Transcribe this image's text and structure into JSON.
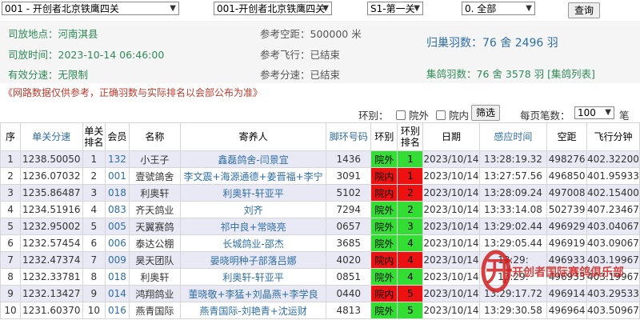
{
  "toolbar": {
    "select1": "001 - 开创者北京铁鹰四关",
    "select2": "001-开创者北京铁鹰四关",
    "select3": "S1-第一关",
    "select4": "0. 全部",
    "query_button": "查询"
  },
  "info": {
    "release_place_label": "司放地点：",
    "release_place": "河南淇县",
    "release_time_label": "司放时间：",
    "release_time": "2023-10-14 06:46:00",
    "valid_speed_label": "有效分速：",
    "valid_speed": "无限制",
    "ref_distance_label": "参考空距：",
    "ref_distance": "500000 米",
    "ref_flight_label": "参考飞行：",
    "ref_flight": "已结束",
    "ref_speed_label": "参考分速：",
    "ref_speed": "已结束",
    "homing_label": "归巢羽数：",
    "homing": "76 舍 2496 羽",
    "collect_label": "集鸽羽数：",
    "collect": "76 舍 3578 羽",
    "collect_list_link": "[集鸽列表]"
  },
  "notice": "《网路数据仅供参考，正确羽数与实际排名以会部公布为准》",
  "filter": {
    "ring_label": "环别：",
    "outer_label": "院外",
    "inner_label": "院内",
    "filter_button": "筛选",
    "page_size_label": "每页笔数：",
    "page_size": "100",
    "unit": "笔"
  },
  "table": {
    "headers": [
      "序",
      "单关分速",
      "单关排名",
      "会员",
      "名称",
      "寄养人",
      "脚环号码",
      "环别",
      "环别排名",
      "日期",
      "感应时间",
      "空距",
      "飞行分钟"
    ],
    "rows": [
      {
        "no": "1",
        "speed": "1238.50050",
        "rank": "1",
        "member": "132",
        "name": "小王子",
        "fosterer": "鑫磊鸽舍-闫景宜",
        "ring": "1436",
        "type": "院外",
        "type_rank": "1",
        "date": "2023/10/14",
        "time": "13:28:19.32",
        "distance": "498276",
        "minutes": "402.32200"
      },
      {
        "no": "2",
        "speed": "1236.07032",
        "rank": "2",
        "member": "001",
        "name": "壹號鴿舍",
        "fosterer": "李文震+海源通德+姜晋福+李宁",
        "ring": "3091",
        "type": "院内",
        "type_rank": "1",
        "date": "2023/10/14",
        "time": "13:27:57.56",
        "distance": "496850",
        "minutes": "401.95933"
      },
      {
        "no": "3",
        "speed": "1235.86487",
        "rank": "3",
        "member": "018",
        "name": "利奥轩",
        "fosterer": "利奥轩-轩亚平",
        "ring": "5102",
        "type": "院内",
        "type_rank": "2",
        "date": "2023/10/14",
        "time": "13:28:09.24",
        "distance": "497008",
        "minutes": "402.15400"
      },
      {
        "no": "4",
        "speed": "1234.51916",
        "rank": "4",
        "member": "083",
        "name": "齐天鸽业",
        "fosterer": "刘齐",
        "ring": "7294",
        "type": "院外",
        "type_rank": "2",
        "date": "2023/10/14",
        "time": "13:33:14.08",
        "distance": "502739",
        "minutes": "407.23467"
      },
      {
        "no": "5",
        "speed": "1232.95002",
        "rank": "5",
        "member": "005",
        "name": "天翼赛鸽",
        "fosterer": "祁中良+常晓亮",
        "ring": "0657",
        "type": "院外",
        "type_rank": "3",
        "date": "2023/10/14",
        "time": "13:29:02.44",
        "distance": "496929",
        "minutes": "403.04067"
      },
      {
        "no": "6",
        "speed": "1232.57454",
        "rank": "6",
        "member": "006",
        "name": "泰达公棚",
        "fosterer": "长城鸽业-邵杰",
        "ring": "3685",
        "type": "院外",
        "type_rank": "4",
        "date": "2023/10/14",
        "time": "13:29:05.44",
        "distance": "496919",
        "minutes": "403.09067"
      },
      {
        "no": "7",
        "speed": "1232.47374",
        "rank": "7",
        "member": "009",
        "name": "昊天团队",
        "fosterer": "晏晓明种子部落吕娜",
        "ring": "4020",
        "type": "院内",
        "type_rank": "4",
        "date": "2023/10/14",
        "time": "13:29:",
        "distance": "496933",
        "minutes": "403.19967"
      },
      {
        "no": "8",
        "speed": "1232.33781",
        "rank": "8",
        "member": "018",
        "name": "利奥轩",
        "fosterer": "利奥轩-轩亚平",
        "ring": "0851",
        "type": "院外",
        "type_rank": "4",
        "date": "2023/10/14",
        "time": "13:29:",
        "distance": "496933",
        "minutes": "403.19967"
      },
      {
        "no": "9",
        "speed": "1232.13427",
        "rank": "9",
        "member": "014",
        "name": "鸿翔鸽业",
        "fosterer": "董晓敬+李猛+刘晶燕+李学良",
        "ring": "0440",
        "type": "院内",
        "type_rank": "5",
        "date": "2023/10/14",
        "time": "13:29:17.72",
        "distance": "496914",
        "minutes": "403.29533"
      },
      {
        "no": "10",
        "speed": "1231.60370",
        "rank": "10",
        "member": "016",
        "name": "燕青国际",
        "fosterer": "燕青国际-刘艳青+沈运财",
        "ring": "4813",
        "type": "院外",
        "type_rank": "5",
        "date": "2023/10/14",
        "time": "13:29:30.58",
        "distance": "496964",
        "minutes": "403.50967"
      }
    ]
  },
  "watermark": {
    "logo_char": "开",
    "club_name": "开创者国际赛鸽俱乐部"
  }
}
